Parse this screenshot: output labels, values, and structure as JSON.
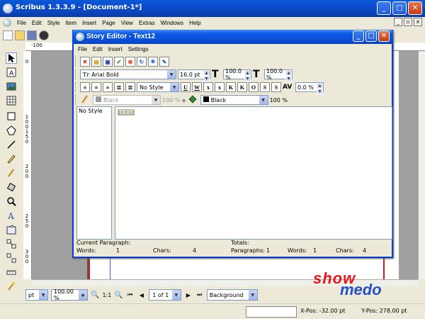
{
  "app": {
    "title": "Scribus 1.3.3.9 - [Document-1*]",
    "menu": [
      "File",
      "Edit",
      "Style",
      "Item",
      "Insert",
      "Page",
      "View",
      "Extras",
      "Windows",
      "Help"
    ]
  },
  "rulers": {
    "h_label": "-100",
    "v_labels": [
      "0",
      "1",
      "0",
      "0",
      "1",
      "5",
      "0",
      "2",
      "0",
      "0",
      "2",
      "5",
      "0",
      "3",
      "0",
      "0"
    ]
  },
  "story_editor": {
    "title": "Story Editor - Text12",
    "menu": [
      "File",
      "Edit",
      "Insert",
      "Settings"
    ],
    "font": "Arial Bold",
    "font_size": "16.0 pt",
    "scale_w": "100.0 %",
    "scale_h": "100.0 %",
    "paragraph_style": "No Style",
    "tracking": "0.0 %",
    "stroke_color": "Black",
    "stroke_shade": "100 %",
    "fill_color": "Black",
    "fill_shade": "100 %",
    "styles_list": [
      "No Style"
    ],
    "text": "TEXT",
    "status": {
      "current_paragraph_label": "Current Paragraph:",
      "words_label": "Words:",
      "words_value": "1",
      "chars_label": "Chars:",
      "chars_value": "4",
      "totals_label": "Totals:",
      "paragraphs_label": "Paragraphs:",
      "paragraphs_value": "1",
      "total_words_label": "Words:",
      "total_words_value": "1",
      "total_chars_label": "Chars:",
      "total_chars_value": "4"
    }
  },
  "bottom": {
    "unit": "pt",
    "zoom": "100.00 %",
    "ratio": "1:1",
    "page": "1 of 1",
    "layer": "Background"
  },
  "status": {
    "xpos": "X-Pos: -32.00 pt",
    "ypos": "Y-Pos: 278.00 pt"
  },
  "logo": {
    "show": "show",
    "medo": "medo"
  }
}
